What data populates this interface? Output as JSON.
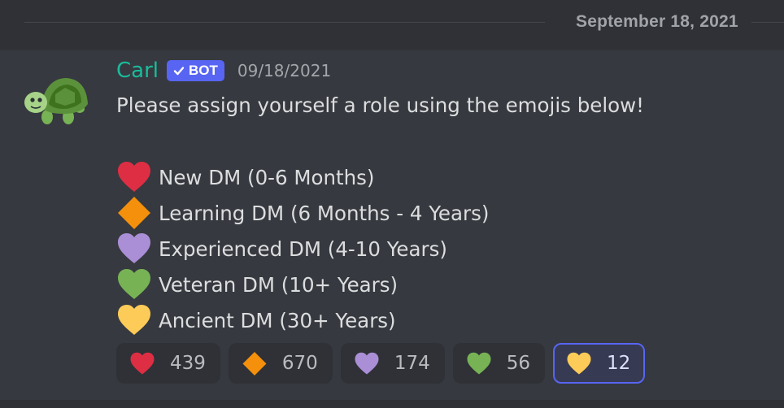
{
  "divider": {
    "date": "September 18, 2021"
  },
  "message": {
    "username": "Carl",
    "bot_badge": "BOT",
    "timestamp": "09/18/2021",
    "intro": "Please assign yourself a role using the emojis below!",
    "avatar_icon": "turtle-icon",
    "roles": [
      {
        "icon": "red-heart-icon",
        "color": "#dd2e44",
        "label": "New DM (0-6 Months)"
      },
      {
        "icon": "orange-diamond-icon",
        "color": "#f4900c",
        "label": "Learning DM (6 Months - 4 Years)"
      },
      {
        "icon": "purple-heart-icon",
        "color": "#aa8ed6",
        "label": "Experienced DM (4-10 Years)"
      },
      {
        "icon": "green-heart-icon",
        "color": "#77b255",
        "label": "Veteran DM (10+ Years)"
      },
      {
        "icon": "yellow-heart-icon",
        "color": "#fdcb58",
        "label": "Ancient DM (30+ Years)"
      }
    ]
  },
  "reactions": [
    {
      "icon": "red-heart-icon",
      "count": "439",
      "selected": false
    },
    {
      "icon": "orange-diamond-icon",
      "count": "670",
      "selected": false
    },
    {
      "icon": "purple-heart-icon",
      "count": "174",
      "selected": false
    },
    {
      "icon": "green-heart-icon",
      "count": "56",
      "selected": false
    },
    {
      "icon": "yellow-heart-icon",
      "count": "12",
      "selected": true
    }
  ],
  "colors": {
    "background": "#36393f",
    "username": "#1abc9c",
    "bot_badge": "#5865f2",
    "selected_reaction_border": "#5865f2"
  }
}
